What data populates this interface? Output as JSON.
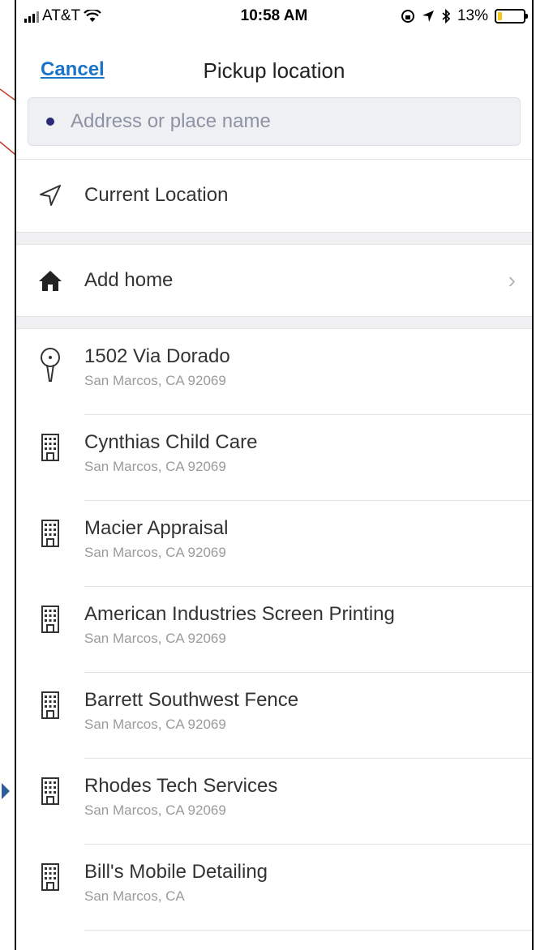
{
  "status_bar": {
    "carrier": "AT&T",
    "time": "10:58 AM",
    "battery": "13%"
  },
  "nav": {
    "cancel_label": "Cancel",
    "title": "Pickup location"
  },
  "search": {
    "placeholder": "Address or place name"
  },
  "current_location": {
    "label": "Current Location"
  },
  "home": {
    "label": "Add home"
  },
  "places": [
    {
      "name": "1502 Via Dorado",
      "address": "San Marcos, CA 92069",
      "icon": "location-pin-icon"
    },
    {
      "name": "Cynthias Child Care",
      "address": "San Marcos, CA 92069",
      "icon": "building-icon"
    },
    {
      "name": "Macier Appraisal",
      "address": "San Marcos, CA 92069",
      "icon": "building-icon"
    },
    {
      "name": "American Industries Screen Printing",
      "address": "San Marcos, CA 92069",
      "icon": "building-icon"
    },
    {
      "name": "Barrett Southwest Fence",
      "address": "San Marcos, CA 92069",
      "icon": "building-icon"
    },
    {
      "name": "Rhodes Tech Services",
      "address": "San Marcos, CA 92069",
      "icon": "building-icon"
    },
    {
      "name": "Bill's Mobile Detailing",
      "address": "San Marcos, CA",
      "icon": "building-icon"
    }
  ],
  "colors": {
    "accent": "#1a73c8",
    "search_bg": "#eef0f4",
    "battery": "#f5c518"
  }
}
